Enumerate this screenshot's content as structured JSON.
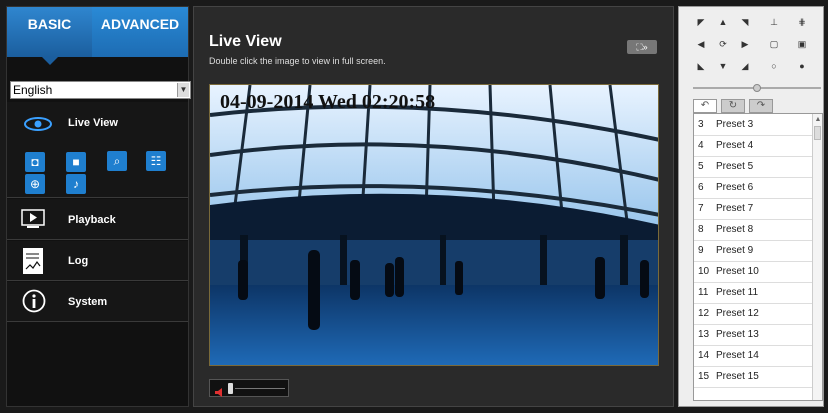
{
  "tabs": {
    "basic": "BASIC",
    "advanced": "ADVANCED"
  },
  "language": {
    "selected": "English"
  },
  "menu": {
    "live_view": "Live View",
    "playback": "Playback",
    "log": "Log",
    "system": "System"
  },
  "live_view": {
    "title": "Live View",
    "subtitle": "Double click the image to view in full screen.",
    "timestamp": "04-09-2014 Wed 02:20:58"
  },
  "presets": [
    {
      "num": "3",
      "name": "Preset 3"
    },
    {
      "num": "4",
      "name": "Preset 4"
    },
    {
      "num": "5",
      "name": "Preset 5"
    },
    {
      "num": "6",
      "name": "Preset 6"
    },
    {
      "num": "7",
      "name": "Preset 7"
    },
    {
      "num": "8",
      "name": "Preset 8"
    },
    {
      "num": "9",
      "name": "Preset 9"
    },
    {
      "num": "10",
      "name": "Preset 10"
    },
    {
      "num": "11",
      "name": "Preset 11"
    },
    {
      "num": "12",
      "name": "Preset 12"
    },
    {
      "num": "13",
      "name": "Preset 13"
    },
    {
      "num": "14",
      "name": "Preset 14"
    },
    {
      "num": "15",
      "name": "Preset 15"
    }
  ],
  "colors": {
    "accent": "#1f7fcf",
    "background": "#1a1a1a"
  }
}
